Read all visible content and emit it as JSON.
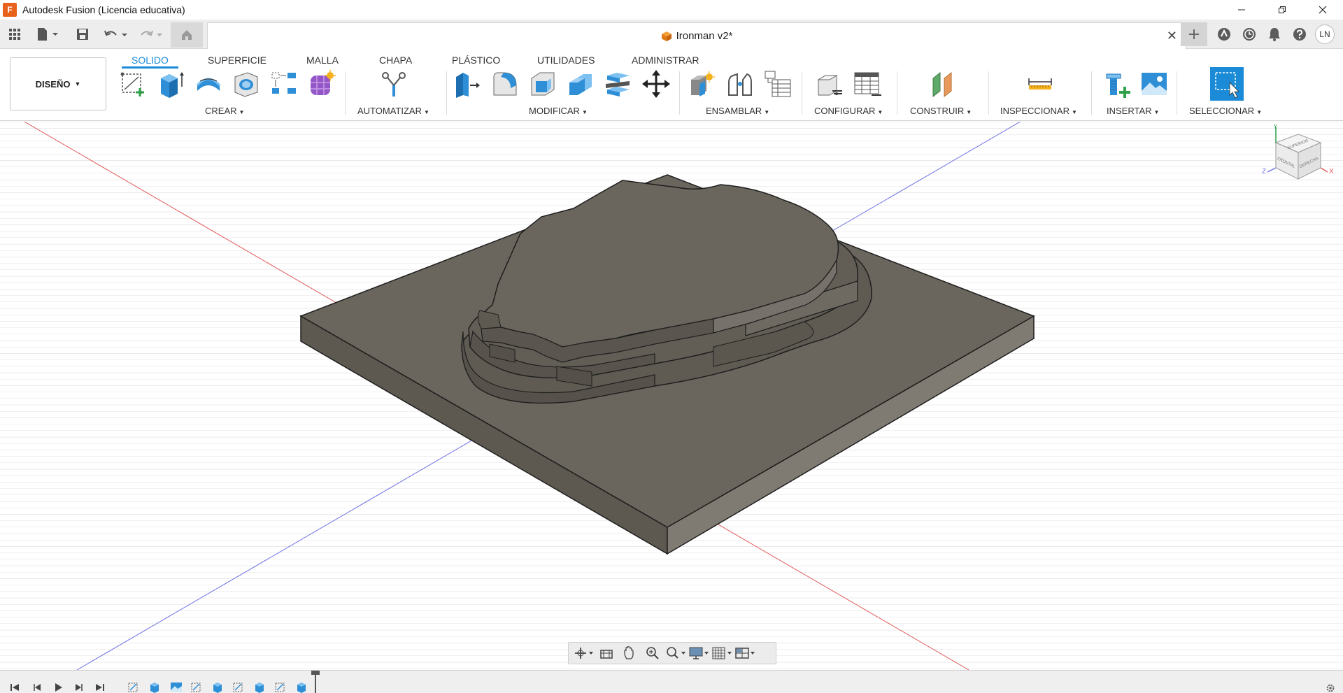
{
  "window": {
    "title": "Autodesk Fusion (Licencia educativa)",
    "app_logo_letter": "F"
  },
  "document": {
    "title": "Ironman v2*",
    "user_initials": "LN"
  },
  "workspace": {
    "label": "DISEÑO"
  },
  "ribbon": {
    "tabs": [
      "SOLIDO",
      "SUPERFICIE",
      "MALLA",
      "CHAPA",
      "PLÁSTICO",
      "UTILIDADES",
      "ADMINISTRAR"
    ],
    "active_tab": "SOLIDO",
    "groups": [
      "CREAR",
      "AUTOMATIZAR",
      "MODIFICAR",
      "ENSAMBLAR",
      "CONFIGURAR",
      "CONSTRUIR",
      "INSPECCIONAR",
      "INSERTAR",
      "SELECCIONAR"
    ]
  },
  "viewcube": {
    "faces": [
      "SUPERIOR",
      "FRONTAL",
      "DERECHA"
    ],
    "axes": [
      "X",
      "Y",
      "Z"
    ]
  },
  "colors": {
    "accent": "#1b8bd8",
    "logo": "#e8621c",
    "model_top": "#6b665d",
    "model_side_left": "#5d5951",
    "model_side_right": "#807b72",
    "axis_x": "#e25a5a",
    "axis_z": "#6f72e6"
  }
}
